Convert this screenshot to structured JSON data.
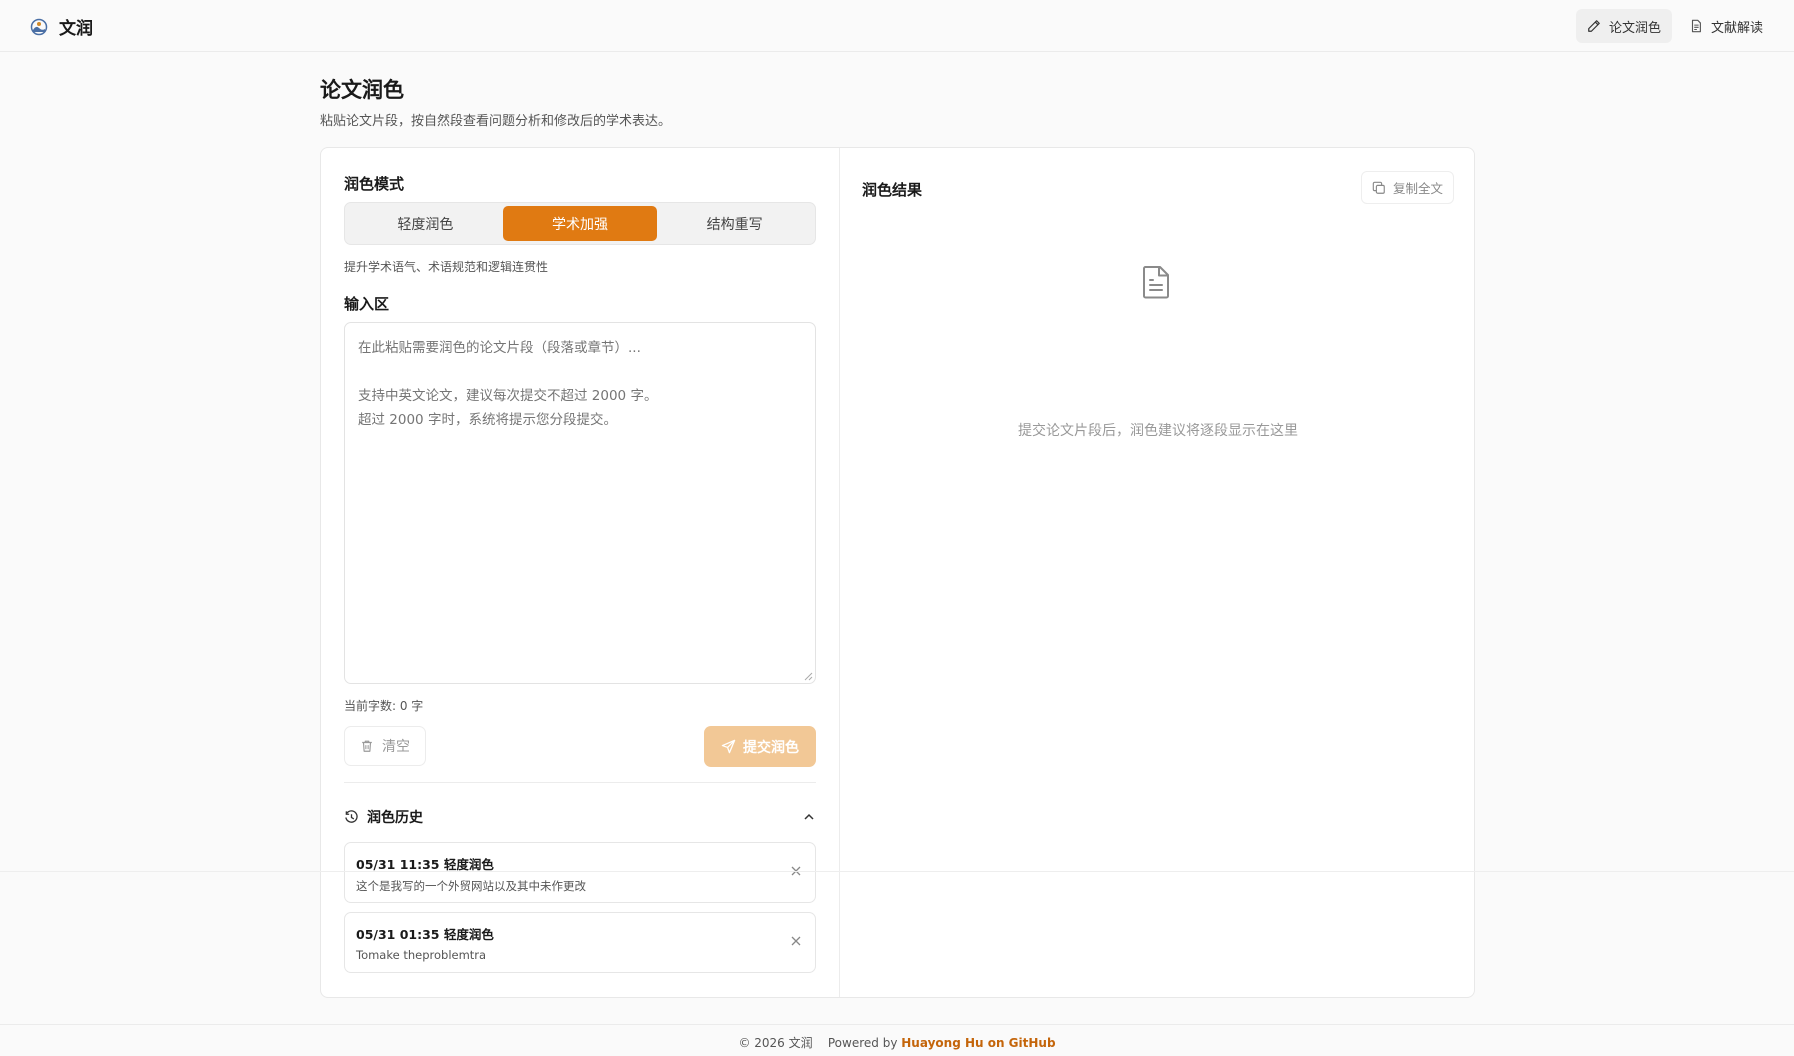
{
  "app": {
    "name": "文润"
  },
  "nav": {
    "items": [
      {
        "label": "论文润色",
        "icon": "pen-icon",
        "active": true
      },
      {
        "label": "文献解读",
        "icon": "document-icon",
        "active": false
      }
    ]
  },
  "page": {
    "title": "论文润色",
    "subtitle": "粘贴论文片段，按自然段查看问题分析和修改后的学术表达。"
  },
  "mode": {
    "label": "润色模式",
    "options": [
      "轻度润色",
      "学术加强",
      "结构重写"
    ],
    "selected": "学术加强",
    "description": "提升学术语气、术语规范和逻辑连贯性"
  },
  "input": {
    "label": "输入区",
    "value": "",
    "placeholder": "在此粘贴需要润色的论文片段（段落或章节）...\n\n支持中英文论文，建议每次提交不超过 2000 字。\n超过 2000 字时，系统将提示您分段提交。",
    "char_count": "当前字数: 0 字"
  },
  "actions": {
    "clear_label": "清空",
    "submit_label": "提交润色"
  },
  "history": {
    "title": "润色历史",
    "items": [
      {
        "title": "05/31 11:35 轻度润色",
        "preview": "这个是我写的一个外贸网站以及其中未作更改"
      },
      {
        "title": "05/31 01:35 轻度润色",
        "preview": "Tomake theproblemtra"
      }
    ]
  },
  "result": {
    "title": "润色结果",
    "copy_label": "复制全文",
    "empty_text": "提交论文片段后，润色建议将逐段显示在这里"
  },
  "footer": {
    "copyright": "© 2026 文润",
    "powered_prefix": "Powered by",
    "powered_link": "Huayong Hu on GitHub"
  },
  "colors": {
    "accent": "#e07a12",
    "accent_disabled": "#f2c896",
    "link": "#c4650a"
  }
}
